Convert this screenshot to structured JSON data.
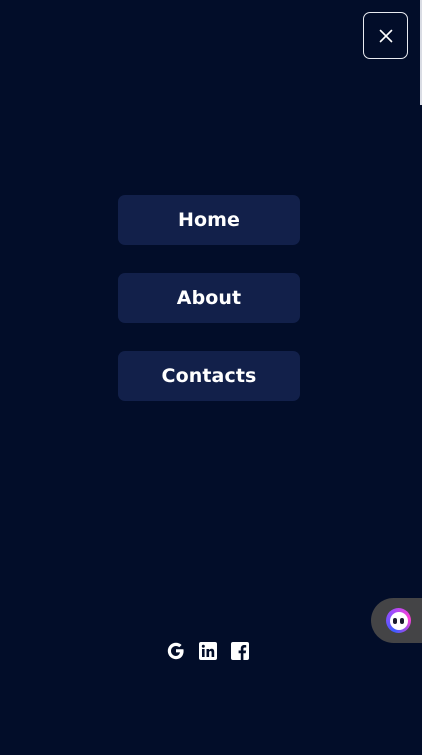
{
  "menu": {
    "close_icon": "close-icon",
    "items": [
      {
        "label": "Home"
      },
      {
        "label": "About"
      },
      {
        "label": "Contacts"
      }
    ]
  },
  "social": [
    {
      "name": "google-icon"
    },
    {
      "name": "linkedin-icon"
    },
    {
      "name": "facebook-icon"
    }
  ],
  "assistant": {
    "icon": "assistant-avatar-icon"
  },
  "colors": {
    "background": "#020d29",
    "nav_item_bg": "#12204a",
    "text": "#ffffff",
    "assistant_tab": "#444446"
  }
}
